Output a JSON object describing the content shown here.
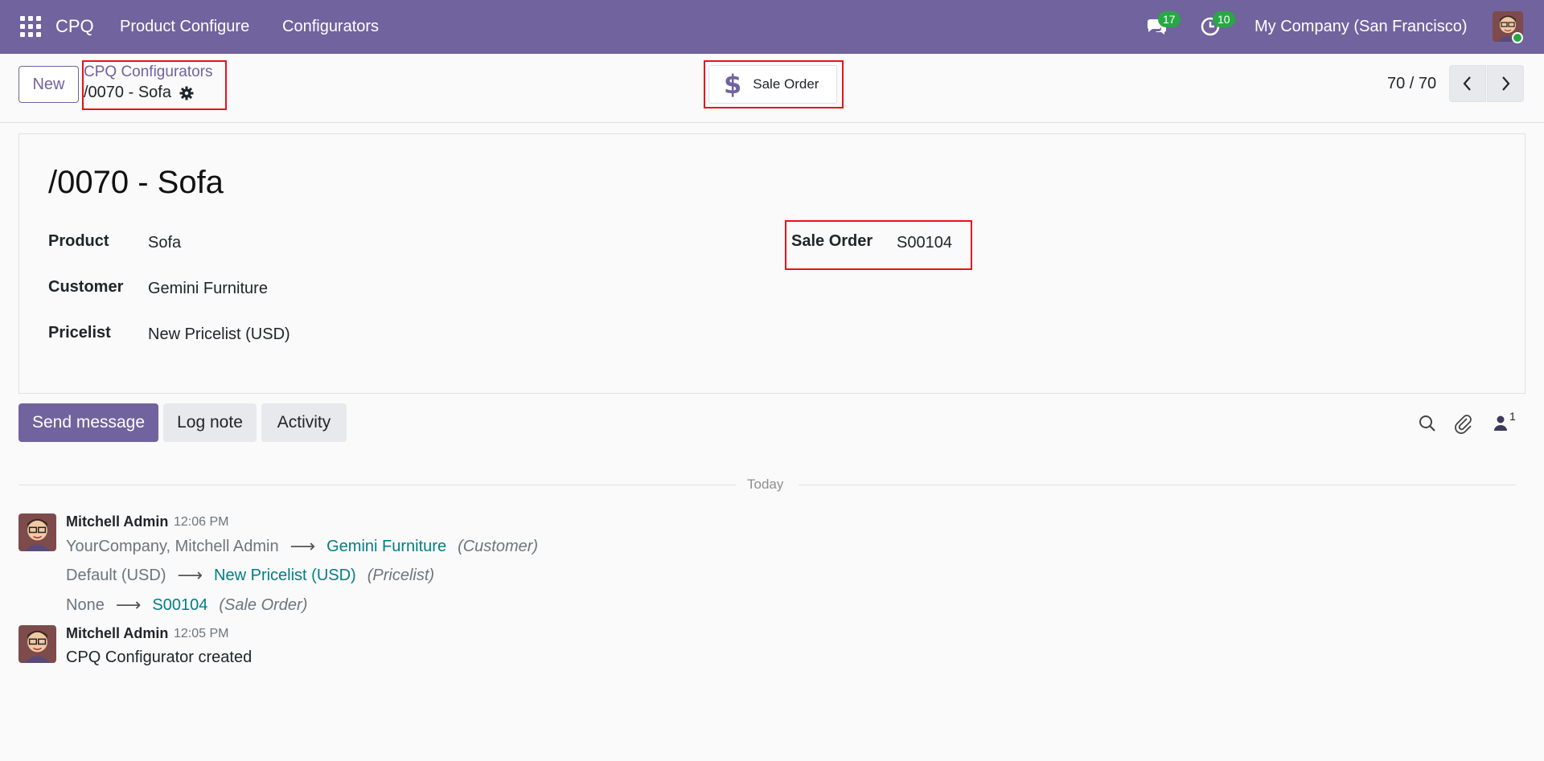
{
  "navbar": {
    "brand": "CPQ",
    "menu": [
      "Product Configure",
      "Configurators"
    ],
    "messages_count": "17",
    "activities_count": "10",
    "company": "My Company (San Francisco)"
  },
  "control": {
    "new_label": "New",
    "breadcrumb_parent": "CPQ Configurators",
    "breadcrumb_current": "/0070 - Sofa",
    "smart_button_label": "Sale Order",
    "pager": "70 / 70"
  },
  "form": {
    "title": "/0070 - Sofa",
    "fields": {
      "product_label": "Product",
      "product_value": "Sofa",
      "customer_label": "Customer",
      "customer_value": "Gemini Furniture",
      "pricelist_label": "Pricelist",
      "pricelist_value": "New Pricelist (USD)",
      "sale_order_label": "Sale Order",
      "sale_order_value": "S00104"
    }
  },
  "chatter": {
    "send_message": "Send message",
    "log_note": "Log note",
    "activity": "Activity",
    "followers_count": "1",
    "divider": "Today",
    "messages": [
      {
        "author": "Mitchell Admin",
        "time": "12:06 PM",
        "tracking": [
          {
            "old": "YourCompany, Mitchell Admin",
            "new": "Gemini Furniture",
            "field": "(Customer)"
          },
          {
            "old": "Default (USD)",
            "new": "New Pricelist (USD)",
            "field": "(Pricelist)"
          },
          {
            "old": "None",
            "new": "S00104",
            "field": "(Sale Order)"
          }
        ]
      },
      {
        "author": "Mitchell Admin",
        "time": "12:05 PM",
        "body": "CPQ Configurator created"
      }
    ]
  },
  "icons": {
    "arrow": "⟶"
  }
}
